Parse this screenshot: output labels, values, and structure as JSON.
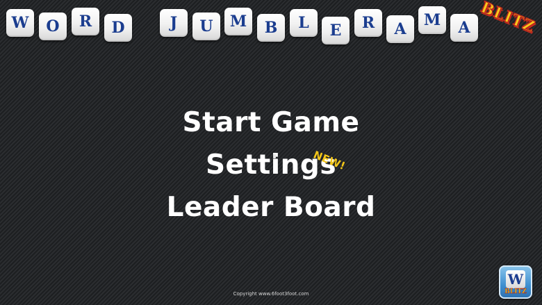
{
  "title": {
    "word1": [
      "W",
      "O",
      "R",
      "D"
    ],
    "word2": [
      "J",
      "U",
      "M",
      "B",
      "L",
      "E",
      "R",
      "A",
      "M",
      "A"
    ],
    "stamp": "BLITZ"
  },
  "menu": {
    "start_game": "Start Game",
    "settings": "Settings",
    "new_badge": "NEW!",
    "leader_board": "Leader Board"
  },
  "footer": {
    "copyright": "Copyright www.6foot3foot.com"
  },
  "app_icon": {
    "letter": "W",
    "label": "BLITZ"
  },
  "colors": {
    "tile_letter": "#1b3d8f",
    "menu_text": "#ffffff",
    "accent_yellow": "#f3c619",
    "accent_red": "#c62d1f"
  }
}
